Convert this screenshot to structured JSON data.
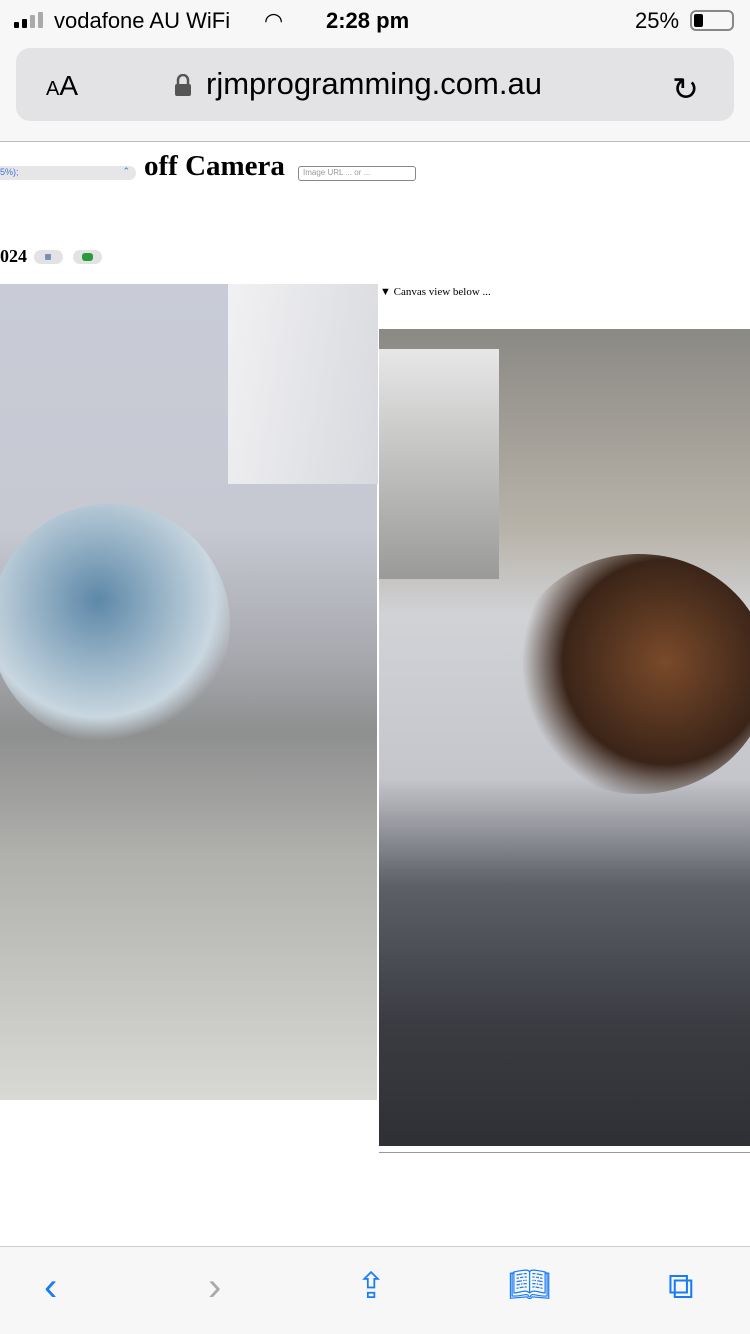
{
  "status": {
    "carrier": "vodafone AU WiFi",
    "time": "2:28 pm",
    "battery": "25%",
    "battery_level": 0.25
  },
  "browser": {
    "text_size": "AA",
    "domain": "rjmprogramming.com.au"
  },
  "page": {
    "select_value": "5%);",
    "heading": "off Camera",
    "image_url_placeholder": "Image URL ... or ...",
    "year_fragment": "024",
    "canvas_summary": "Canvas view below ..."
  },
  "toolbar": {
    "back": "back-icon",
    "forward": "forward-icon",
    "share": "share-icon",
    "bookmarks": "bookmarks-icon",
    "tabs": "tabs-icon"
  }
}
